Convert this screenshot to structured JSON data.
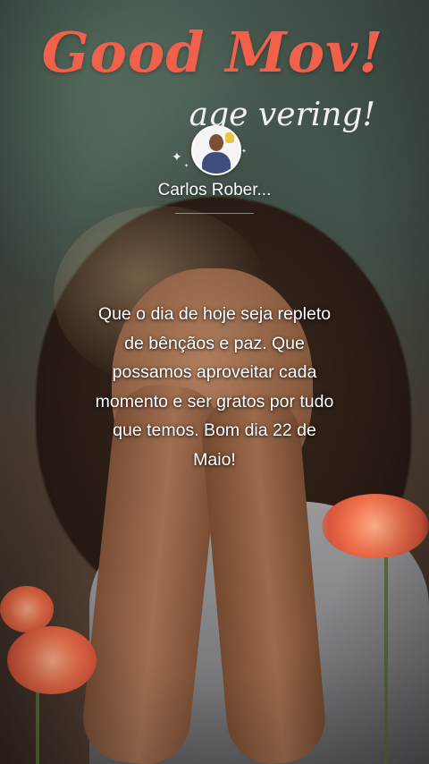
{
  "header": {
    "title": "Good Mov!",
    "subtitle": "age vering!"
  },
  "author": {
    "avatar_icon": "profile-photo",
    "name": "Carlos Rober..."
  },
  "message": {
    "text": "Que o dia de hoje seja repleto de bênçãos e paz. Que possamos aproveitar cada momento e ser gratos por tudo que temos. Bom dia 22 de Maio!"
  },
  "colors": {
    "title": "#f0604a",
    "text": "#ffffff",
    "flowers": "#f0704c"
  }
}
